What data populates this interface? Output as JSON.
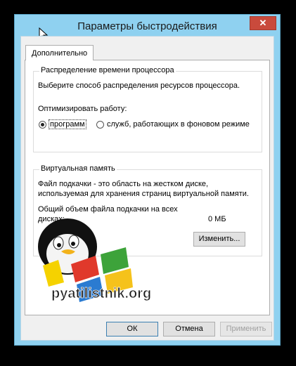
{
  "window": {
    "title": "Параметры быстродействия",
    "close_symbol": "✕"
  },
  "tabs": [
    {
      "label": "Дополнительно"
    }
  ],
  "cpu_group": {
    "title": "Распределение времени процессора",
    "description": "Выберите способ распределения ресурсов процессора.",
    "optimize_label": "Оптимизировать работу:",
    "options": [
      {
        "label": "программ",
        "selected": true
      },
      {
        "label": "служб, работающих в фоновом режиме",
        "selected": false
      }
    ]
  },
  "vm_group": {
    "title": "Виртуальная память",
    "desc_line1": "Файл подкачки - это область на жестком диске,",
    "desc_line2": "используемая для хранения страниц виртуальной памяти.",
    "total_line1": "Общий объем файла подкачки на всех",
    "total_line2": "дисках:",
    "total_value": "0 МБ",
    "change_button": "Изменить..."
  },
  "footer": {
    "ok": "ОК",
    "cancel": "Отмена",
    "apply": "Применить"
  },
  "watermark": {
    "text": "pyatilistnik.org"
  },
  "colors": {
    "titlebar": "#8fd1f0",
    "close": "#c94a3c"
  }
}
